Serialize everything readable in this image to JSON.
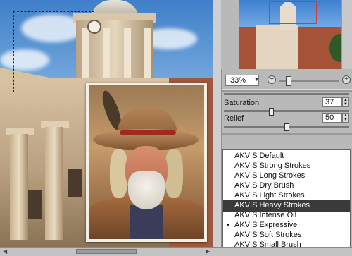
{
  "colors": {
    "selection_highlight": "#3a3a3a",
    "panel_bg": "#b9b9b9",
    "nav_box": "#d43a3a"
  },
  "zoom": {
    "value": "33%",
    "minus": "−",
    "plus": "+"
  },
  "params": [
    {
      "label": "Saturation",
      "value": "37",
      "level": 0.37
    },
    {
      "label": "Relief",
      "value": "50",
      "level": 0.5
    }
  ],
  "presets": {
    "items": [
      {
        "label": "AKVIS Default"
      },
      {
        "label": "AKVIS Strong Strokes"
      },
      {
        "label": "AKVIS Long Strokes"
      },
      {
        "label": "AKVIS Dry Brush"
      },
      {
        "label": "AKVIS Light Strokes"
      },
      {
        "label": "AKVIS Heavy Strokes",
        "selected": true
      },
      {
        "label": "AKVIS Intense Oil"
      },
      {
        "label": "AKVIS Expressive",
        "bullet": "•"
      },
      {
        "label": "AKVIS Soft Strokes"
      },
      {
        "label": "AKVIS Small Brush"
      }
    ]
  }
}
